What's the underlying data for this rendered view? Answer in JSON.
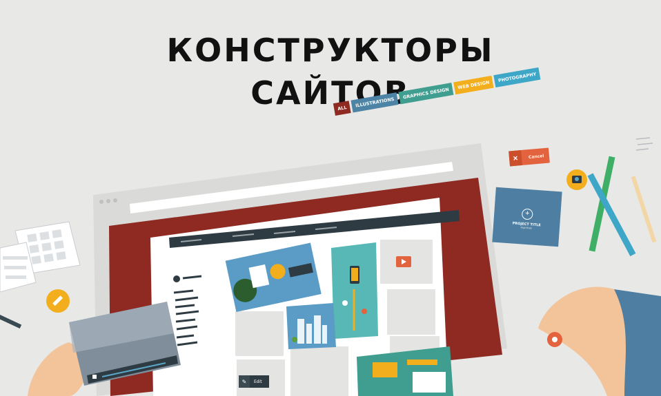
{
  "title": {
    "line1": "КОНСТРУКТОРЫ",
    "line2": "САЙТОВ"
  },
  "tags": [
    {
      "label": "ALL",
      "color": "#8f2a22"
    },
    {
      "label": "ILLUSTRATIONS",
      "color": "#4d83a5"
    },
    {
      "label": "GRAPHICS DESIGN",
      "color": "#3f9e8f"
    },
    {
      "label": "WEB DESIGN",
      "color": "#f2ae1c"
    },
    {
      "label": "PHOTOGRAPHY",
      "color": "#3ea6c7"
    }
  ],
  "cancel_button": {
    "label": "Cancel",
    "icon": "close-icon"
  },
  "project_card": {
    "title": "PROJECT TITLE",
    "subtitle": "Digit Mode",
    "icon": "plus-icon"
  },
  "edit_button": {
    "label": "Edit",
    "icon": "pencil-icon"
  },
  "colors": {
    "frame": "#8f2a22",
    "browser": "#dadad8",
    "accent_blue": "#4e7fa3",
    "accent_orange": "#e2633d",
    "background": "#e8e8e6"
  }
}
